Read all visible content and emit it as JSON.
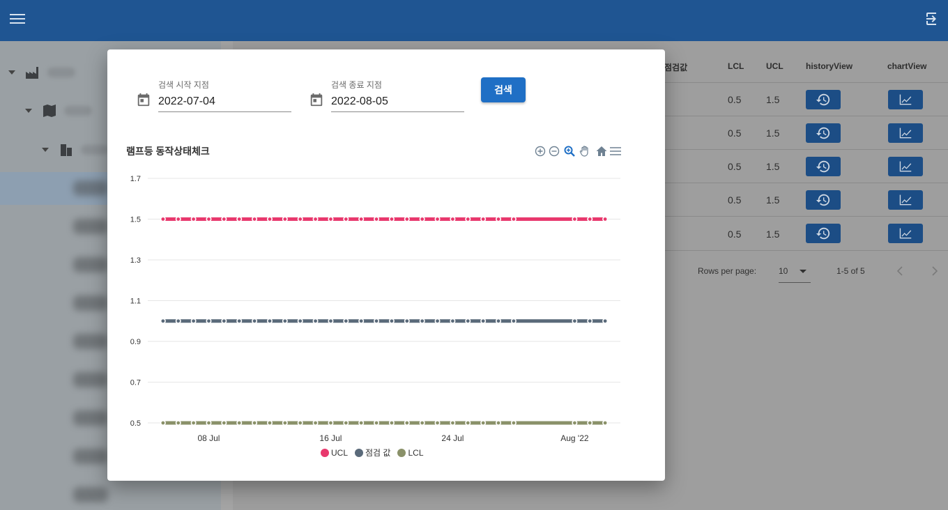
{
  "colors": {
    "appbar": "#1f5592",
    "button": "#1f6fc5",
    "ucl": "#e8386d",
    "measure": "#5a6a7a",
    "lcl": "#8a9169"
  },
  "appbar": {
    "menu_icon": "hamburger-icon",
    "logout_icon": "logout-icon"
  },
  "table": {
    "headers": [
      "점검값",
      "LCL",
      "UCL",
      "historyView",
      "chartView"
    ],
    "rows": [
      {
        "lcl": "0.5",
        "ucl": "1.5"
      },
      {
        "lcl": "0.5",
        "ucl": "1.5"
      },
      {
        "lcl": "0.5",
        "ucl": "1.5"
      },
      {
        "lcl": "0.5",
        "ucl": "1.5"
      },
      {
        "lcl": "0.5",
        "ucl": "1.5"
      }
    ],
    "history_icon": "history-icon",
    "chart_icon": "line-chart-icon"
  },
  "pagination": {
    "rows_per_page_label": "Rows per page:",
    "rows_per_page_value": "10",
    "range_text": "1-5 of 5"
  },
  "dialog": {
    "start_label": "검색 시작 지점",
    "start_value": "2022-07-04",
    "end_label": "검색 종료 지점",
    "end_value": "2022-08-05",
    "search_button": "검색",
    "chart_title": "램프등 동작상태체크",
    "toolbar_icons": [
      "zoom-in-icon",
      "zoom-out-icon",
      "magnifier-icon",
      "pan-hand-icon",
      "home-icon",
      "menu-icon"
    ]
  },
  "chart_data": {
    "type": "line",
    "title": "램프등 동작상태체크",
    "xlabel": "",
    "ylabel": "",
    "x_ticks": [
      "08 Jul",
      "16 Jul",
      "24 Jul",
      "Aug '22"
    ],
    "y_ticks": [
      "1.7",
      "1.5",
      "1.3",
      "1.1",
      "0.9",
      "0.7",
      "0.5"
    ],
    "ylim": [
      0.5,
      1.7
    ],
    "x_dates": [
      "2022-07-05",
      "2022-07-06",
      "2022-07-07",
      "2022-07-08",
      "2022-07-09",
      "2022-07-10",
      "2022-07-11",
      "2022-07-12",
      "2022-07-13",
      "2022-07-14",
      "2022-07-15",
      "2022-07-16",
      "2022-07-17",
      "2022-07-18",
      "2022-07-19",
      "2022-07-20",
      "2022-07-21",
      "2022-07-22",
      "2022-07-23",
      "2022-07-24",
      "2022-07-25",
      "2022-07-26",
      "2022-07-27",
      "2022-07-28",
      "2022-08-01",
      "2022-08-02",
      "2022-08-03"
    ],
    "series": [
      {
        "name": "UCL",
        "value": 1.5
      },
      {
        "name": "점검 값",
        "value": 1.0
      },
      {
        "name": "LCL",
        "value": 0.5
      }
    ],
    "legend": "bottom"
  }
}
